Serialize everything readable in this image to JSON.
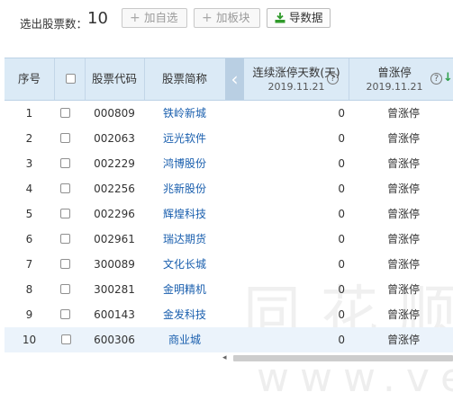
{
  "toolbar": {
    "selected_label": "选出股票数：",
    "selected_count": "10",
    "add_self_label": "加自选",
    "add_block_label": "加板块",
    "export_label": "导数据"
  },
  "table": {
    "headers": {
      "index": "序号",
      "code": "股票代码",
      "name": "股票简称",
      "days": "连续涨停天数(天)",
      "days_date": "2019.11.21",
      "reason": "曾涨停",
      "reason_date": "2019.11.21"
    },
    "rows": [
      {
        "index": "1",
        "code": "000809",
        "name": "铁岭新城",
        "days": "0",
        "reason": "曾涨停"
      },
      {
        "index": "2",
        "code": "002063",
        "name": "远光软件",
        "days": "0",
        "reason": "曾涨停"
      },
      {
        "index": "3",
        "code": "002229",
        "name": "鸿博股份",
        "days": "0",
        "reason": "曾涨停"
      },
      {
        "index": "4",
        "code": "002256",
        "name": "兆新股份",
        "days": "0",
        "reason": "曾涨停"
      },
      {
        "index": "5",
        "code": "002296",
        "name": "辉煌科技",
        "days": "0",
        "reason": "曾涨停"
      },
      {
        "index": "6",
        "code": "002961",
        "name": "瑞达期货",
        "days": "0",
        "reason": "曾涨停"
      },
      {
        "index": "7",
        "code": "300089",
        "name": "文化长城",
        "days": "0",
        "reason": "曾涨停"
      },
      {
        "index": "8",
        "code": "300281",
        "name": "金明精机",
        "days": "0",
        "reason": "曾涨停"
      },
      {
        "index": "9",
        "code": "600143",
        "name": "金发科技",
        "days": "0",
        "reason": "曾涨停"
      },
      {
        "index": "10",
        "code": "600306",
        "name": "商业城",
        "days": "0",
        "reason": "曾涨停"
      }
    ]
  },
  "watermark": {
    "line1": "同花顺",
    "line2": "www.ve"
  },
  "icons": {
    "add": "plus-icon",
    "export": "download-icon",
    "help": "question-circle-icon",
    "sort": "sort-arrows-icon",
    "scroll": "chevron-left-icon"
  },
  "colors": {
    "header_bg": "#dbeaf6",
    "link": "#1a5fae",
    "selected_row": "#ebf3fb",
    "export_icon": "#2f9a2a"
  }
}
